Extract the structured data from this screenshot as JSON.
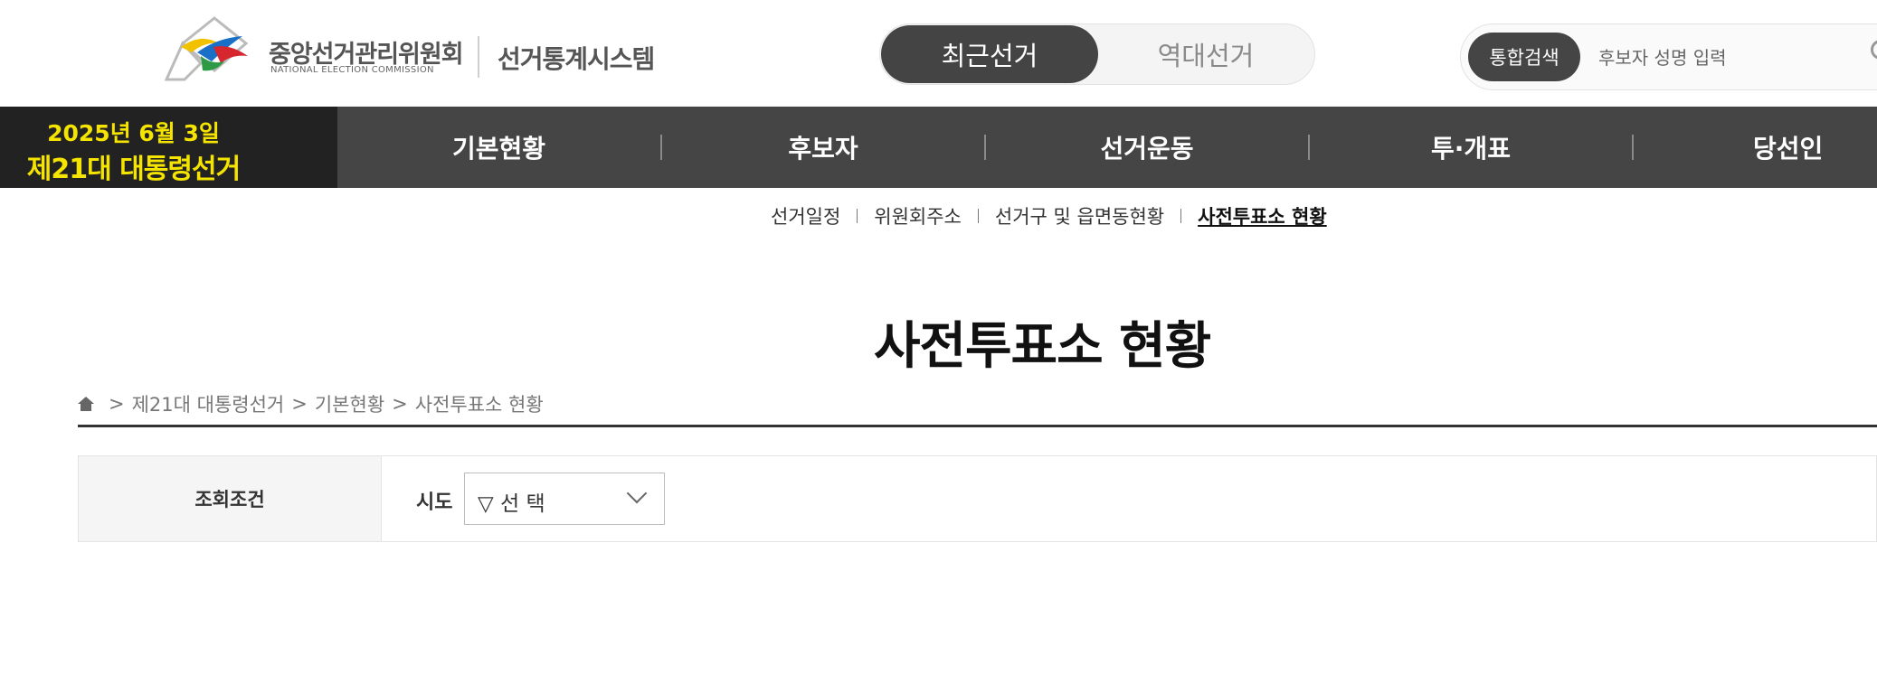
{
  "header": {
    "org_name": "중앙선거관리위원회",
    "org_name_en": "NATIONAL ELECTION COMMISSION",
    "system_name": "선거통계시스템",
    "toggle": {
      "recent": "최근선거",
      "past": "역대선거"
    },
    "search": {
      "badge": "통합검색",
      "placeholder": "후보자 성명 입력"
    }
  },
  "election": {
    "date": "2025년 6월 3일",
    "name": "제21대 대통령선거"
  },
  "nav": {
    "items": [
      "기본현황",
      "후보자",
      "선거운동",
      "투·개표",
      "당선인"
    ]
  },
  "subnav": {
    "items": [
      "선거일정",
      "위원회주소",
      "선거구 및 읍면동현황",
      "사전투표소 현황"
    ],
    "active_index": 3
  },
  "page": {
    "title": "사전투표소 현황"
  },
  "breadcrumb": {
    "items": [
      "제21대 대통령선거",
      "기본현황",
      "사전투표소 현황"
    ],
    "separator": ">"
  },
  "filter": {
    "label": "조회조건",
    "field_label": "시도",
    "select_value": "▽ 선 택"
  },
  "colors": {
    "accent_yellow": "#f5e400",
    "nav_bg": "#454545",
    "election_bg": "#222222"
  },
  "icons": {
    "home": "home-icon",
    "search": "search-icon",
    "dropdown": "chevron-down-icon"
  }
}
